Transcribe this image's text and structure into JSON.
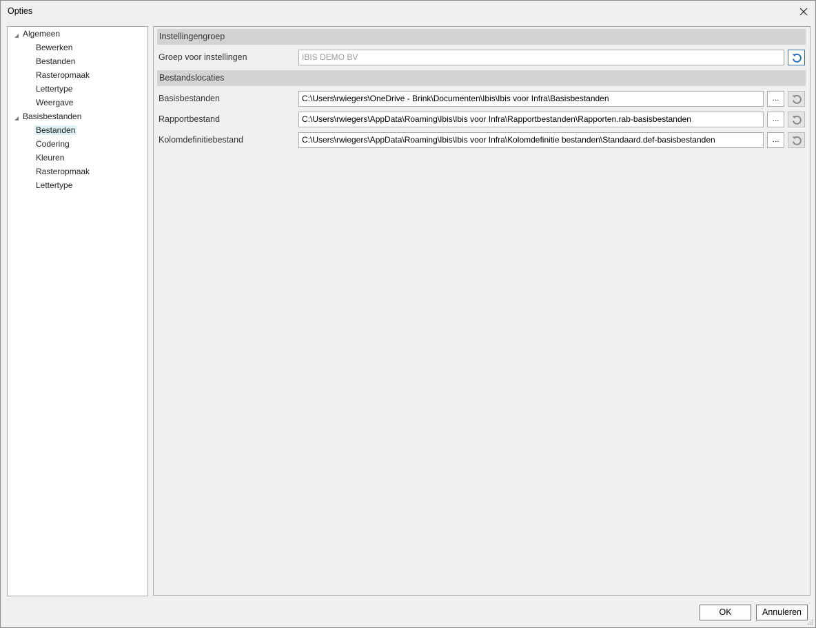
{
  "window": {
    "title": "Opties"
  },
  "tree": {
    "groups": [
      {
        "label": "Algemeen",
        "children": [
          "Bewerken",
          "Bestanden",
          "Rasteropmaak",
          "Lettertype",
          "Weergave"
        ]
      },
      {
        "label": "Basisbestanden",
        "children": [
          "Bestanden",
          "Codering",
          "Kleuren",
          "Rasteropmaak",
          "Lettertype"
        ],
        "selected_child": "Bestanden"
      }
    ]
  },
  "settings": {
    "group1": {
      "header": "Instellingengroep",
      "rows": [
        {
          "label": "Groep voor instellingen",
          "value": "IBIS DEMO BV"
        }
      ]
    },
    "group2": {
      "header": "Bestandslocaties",
      "rows": [
        {
          "label": "Basisbestanden",
          "value": "C:\\Users\\rwiegers\\OneDrive - Brink\\Documenten\\Ibis\\Ibis voor Infra\\Basisbestanden",
          "browse": "..."
        },
        {
          "label": "Rapportbestand",
          "value": "C:\\Users\\rwiegers\\AppData\\Roaming\\Ibis\\Ibis voor Infra\\Rapportbestanden\\Rapporten.rab-basisbestanden",
          "browse": "..."
        },
        {
          "label": "Kolomdefinitiebestand",
          "value": "C:\\Users\\rwiegers\\AppData\\Roaming\\Ibis\\Ibis voor Infra\\Kolomdefinitie bestanden\\Standaard.def-basisbestanden",
          "browse": "..."
        }
      ]
    }
  },
  "buttons": {
    "ok": "OK",
    "cancel": "Annuleren"
  },
  "colors": {
    "accent": "#2f6db5",
    "selection": "#dff1f4",
    "group_header": "#d3d3d3"
  }
}
